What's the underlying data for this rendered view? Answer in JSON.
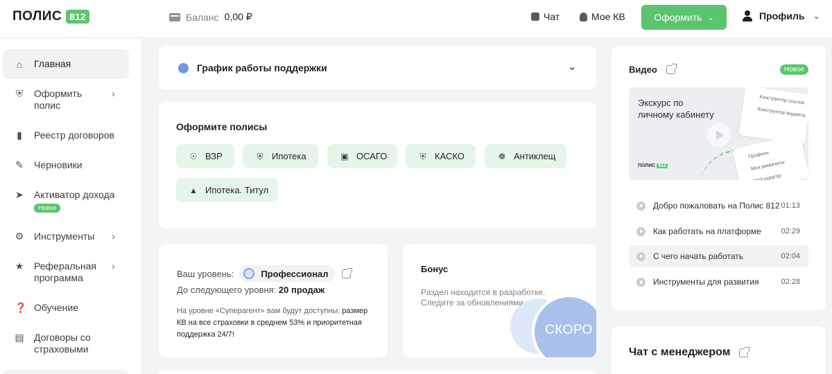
{
  "header": {
    "logo_text": "ПОЛИС",
    "logo_badge": "812",
    "balance_label": "Баланс",
    "balance_value": "0,00 ₽",
    "chat_label": "Чат",
    "kv_label": "Мое КВ",
    "order_button": "Оформить",
    "profile_label": "Профиль"
  },
  "sidebar": {
    "items": [
      {
        "label": "Главная",
        "icon": "home-icon"
      },
      {
        "label": "Оформить полис",
        "icon": "shield-icon"
      },
      {
        "label": "Реестр договоров",
        "icon": "document-icon"
      },
      {
        "label": "Черновики",
        "icon": "edit-icon"
      },
      {
        "label": "Активатор дохода",
        "icon": "rocket-icon",
        "badge": "Новое"
      },
      {
        "label": "Инструменты",
        "icon": "gear-icon"
      },
      {
        "label": "Реферальная программа",
        "icon": "star-icon"
      },
      {
        "label": "Обучение",
        "icon": "question-icon"
      },
      {
        "label": "Договоры со страховыми",
        "icon": "contract-icon"
      }
    ]
  },
  "support": {
    "title": "График работы поддержки"
  },
  "policies": {
    "title": "Оформите полисы",
    "chips": [
      {
        "label": "ВЗР",
        "icon": "globe-icon"
      },
      {
        "label": "Ипотека",
        "icon": "shield-icon"
      },
      {
        "label": "ОСАГО",
        "icon": "car-icon"
      },
      {
        "label": "КАСКО",
        "icon": "shield-check-icon"
      },
      {
        "label": "Антиклещ",
        "icon": "bug-icon"
      },
      {
        "label": "Ипотека. Титул",
        "icon": "title-icon"
      }
    ]
  },
  "level": {
    "label": "Ваш уровень:",
    "value": "Профессионал",
    "next_label": "До следующего уровня:",
    "next_value": "20 продаж",
    "desc_prefix": "На уровне «Суперагент» вам будут доступны:",
    "desc_bold": "размер КВ на все страховки в среднем 53% и приоритетная поддержка 24/7!"
  },
  "bonus": {
    "title": "Бонус",
    "text": "Раздел находится в разработке. Следите за обновлениями",
    "soon": "СКОРО"
  },
  "video": {
    "title": "Видео",
    "badge": "Новое",
    "thumb_text": "Экскурс по личному кабинету",
    "thumb_logo": "ПОЛИС",
    "thumb_logo_badge": "812",
    "thumb_card1_lines": [
      "Конструктор ссылок",
      "Конструктор виджета"
    ],
    "thumb_card2_lines": [
      "Профиль",
      "Мои реквизиты",
      "Мой куратор"
    ],
    "items": [
      {
        "title": "Добро пожаловать на Полис 812",
        "time": "01:13"
      },
      {
        "title": "Как работать на платформе",
        "time": "02:29"
      },
      {
        "title": "С чего начать работать",
        "time": "02:04"
      },
      {
        "title": "Инструменты для развития",
        "time": "02:28"
      }
    ]
  },
  "chat": {
    "title": "Чат с менеджером"
  },
  "colors": {
    "accent": "#5cc46f",
    "chip_bg": "#e6f5e9",
    "info_blue": "#6f97e8"
  }
}
